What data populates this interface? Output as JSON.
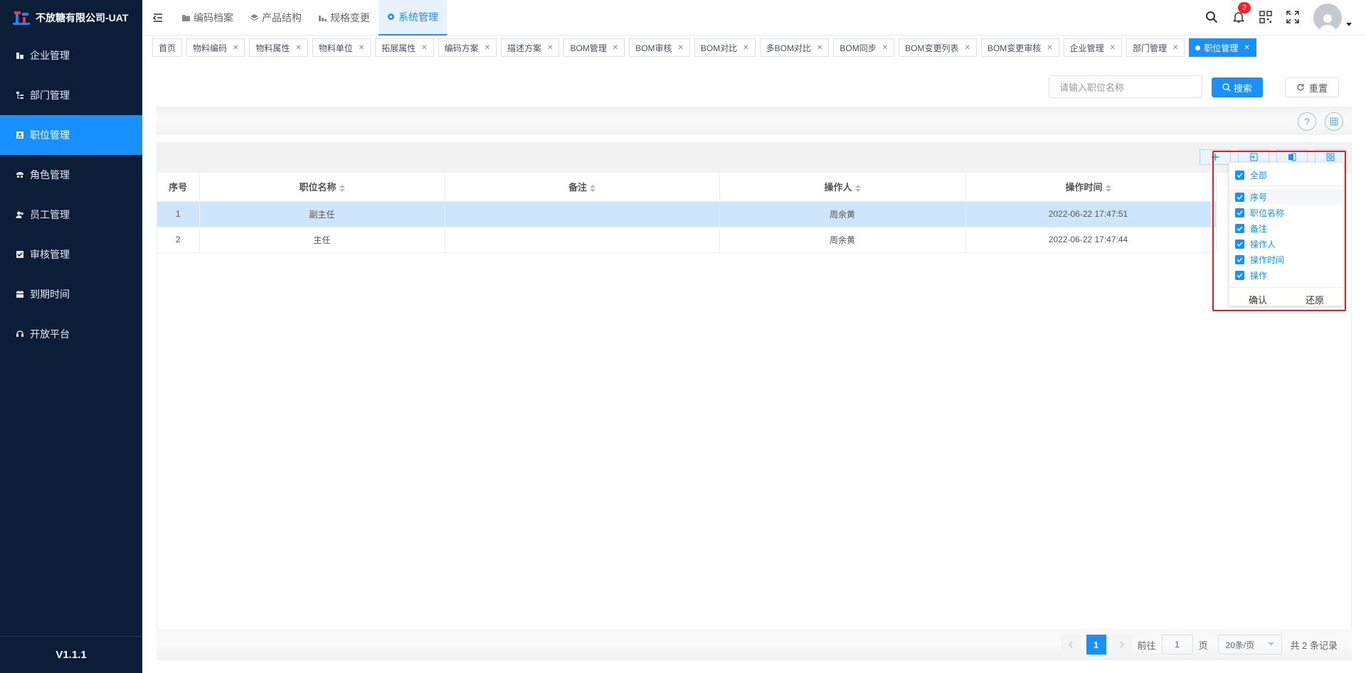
{
  "app": {
    "name": "不放糖有限公司-UAT",
    "version": "V1.1.1"
  },
  "sidebar": {
    "items": [
      {
        "label": "企业管理",
        "icon": "building-icon"
      },
      {
        "label": "部门管理",
        "icon": "org-tree-icon"
      },
      {
        "label": "职位管理",
        "icon": "id-card-icon",
        "active": true
      },
      {
        "label": "角色管理",
        "icon": "role-icon"
      },
      {
        "label": "员工管理",
        "icon": "users-icon"
      },
      {
        "label": "审核管理",
        "icon": "check-square-icon"
      },
      {
        "label": "到期时间",
        "icon": "calendar-icon"
      },
      {
        "label": "开放平台",
        "icon": "headset-icon"
      }
    ]
  },
  "topnav": {
    "items": [
      {
        "label": "编码档案",
        "icon": "folder-icon"
      },
      {
        "label": "产品结构",
        "icon": "layers-icon"
      },
      {
        "label": "规格变更",
        "icon": "chart-icon"
      },
      {
        "label": "系统管理",
        "icon": "settings-icon",
        "active": true
      }
    ]
  },
  "header": {
    "notification_count": "2"
  },
  "tabs": [
    "首页",
    "物料编码",
    "物料属性",
    "物料单位",
    "拓展属性",
    "编码方案",
    "描述方案",
    "BOM管理",
    "BOM审核",
    "BOM对比",
    "多BOM对比",
    "BOM同步",
    "BOM变更列表",
    "BOM变更审核",
    "企业管理",
    "部门管理",
    "职位管理"
  ],
  "search": {
    "placeholder": "请输入职位名称",
    "search_label": "搜索",
    "reset_label": "重置",
    "help": "?"
  },
  "table": {
    "columns": [
      "序号",
      "职位名称",
      "备注",
      "操作人",
      "操作时间"
    ],
    "rows": [
      {
        "index": "1",
        "name": "副主任",
        "remark": "",
        "operator": "周余黄",
        "time": "2022-06-22 17:47:51"
      },
      {
        "index": "2",
        "name": "主任",
        "remark": "",
        "operator": "周余黄",
        "time": "2022-06-22 17:47:44"
      }
    ]
  },
  "column_picker": {
    "all_label": "全部",
    "items": [
      "序号",
      "职位名称",
      "备注",
      "操作人",
      "操作时间",
      "操作"
    ],
    "confirm": "确认",
    "restore": "还原"
  },
  "pagination": {
    "current": "1",
    "goto_prefix": "前往",
    "goto_value": "1",
    "goto_suffix": "页",
    "page_size": "20条/页",
    "total": "共 2 条记录"
  },
  "colors": {
    "sidebar_bg": "#0c1e37",
    "accent": "#1890ff",
    "highlight_border": "#e02020"
  }
}
